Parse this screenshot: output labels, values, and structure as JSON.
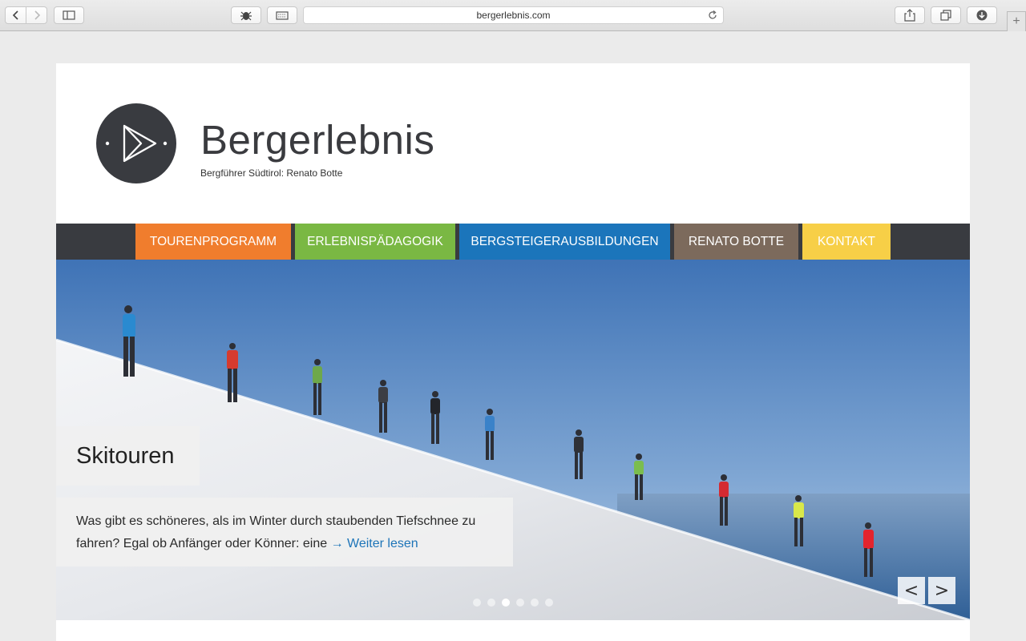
{
  "browser": {
    "url": "bergerlebnis.com",
    "icons": [
      "back-icon",
      "forward-icon",
      "sidebar-icon",
      "bug-icon",
      "keyboard-icon",
      "reload-icon",
      "share-icon",
      "tabs-icon",
      "download-icon",
      "plus-icon"
    ],
    "new_tab_label": "+"
  },
  "site": {
    "title": "Bergerlebnis",
    "subtitle": "Bergführer Südtirol: Renato Botte"
  },
  "nav": {
    "items": [
      {
        "label": "TOURENPROGRAMM",
        "color": "#f07d2d"
      },
      {
        "label": "ERLEBNISPÄDAGOGIK",
        "color": "#7ab843"
      },
      {
        "label": "BERGSTEIGERAUSBILDUNGEN",
        "color": "#1b75bb"
      },
      {
        "label": "RENATO BOTTE",
        "color": "#7c6a5c"
      },
      {
        "label": "KONTAKT",
        "color": "#f7cf47"
      }
    ]
  },
  "slider": {
    "title": "Skitouren",
    "text": "Was gibt es schöneres, als im Winter durch staubenden Tiefschnee zu fahren? Egal ob Anfänger oder Könner: eine",
    "more_label": "→ Weiter lesen",
    "prev_label": "<",
    "next_label": ">",
    "slide_count": 6,
    "active_slide": 3
  }
}
